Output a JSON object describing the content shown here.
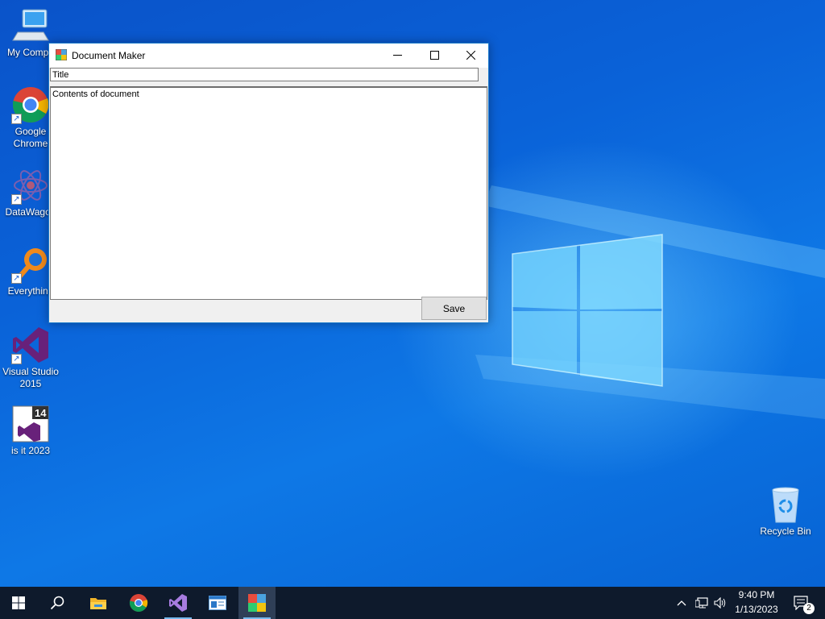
{
  "desktop": {
    "icons": [
      {
        "name": "my-computer",
        "label": "My Compu",
        "label2": "",
        "icon": "computer-icon"
      },
      {
        "name": "google-chrome",
        "label": "Google",
        "label2": "Chrome",
        "icon": "chrome-icon"
      },
      {
        "name": "datawagon",
        "label": "DataWagon",
        "label2": "",
        "icon": "datawagon-icon"
      },
      {
        "name": "everything",
        "label": "Everything",
        "label2": "",
        "icon": "everything-icon"
      },
      {
        "name": "visual-studio-2015",
        "label": "Visual Studio",
        "label2": "2015",
        "icon": "visual-studio-icon"
      },
      {
        "name": "is-it-2023",
        "label": "is it 2023",
        "label2": "",
        "icon": "vs-2014-icon"
      },
      {
        "name": "recycle-bin",
        "label": "Recycle Bin",
        "label2": "",
        "icon": "recycle-bin-icon"
      }
    ]
  },
  "window": {
    "title": "Document Maker",
    "title_field": {
      "value": "Title"
    },
    "contents_field": {
      "value": "Contents of document"
    },
    "save_label": "Save",
    "colors": {
      "border": "#1979ca",
      "background": "#f0f0f0"
    }
  },
  "taskbar": {
    "items": [
      "start-icon",
      "search-icon",
      "file-explorer-icon",
      "chrome-icon",
      "visual-studio-icon",
      "app-window-icon",
      "document-maker-icon"
    ],
    "tray": {
      "time": "9:40 PM",
      "date": "1/13/2023",
      "notification_count": "2"
    },
    "colors": {
      "background": "#0e1a2c",
      "accent": "#76b9ed"
    }
  }
}
